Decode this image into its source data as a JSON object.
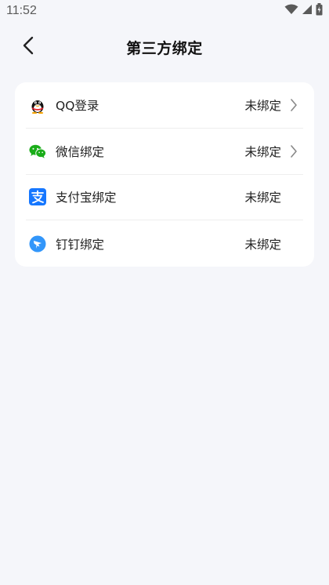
{
  "status_bar": {
    "time": "11:52"
  },
  "header": {
    "title": "第三方绑定"
  },
  "bindings": [
    {
      "label": "QQ登录",
      "status": "未绑定",
      "icon": "qq-icon",
      "has_arrow": true
    },
    {
      "label": "微信绑定",
      "status": "未绑定",
      "icon": "wechat-icon",
      "has_arrow": true
    },
    {
      "label": "支付宝绑定",
      "status": "未绑定",
      "icon": "alipay-icon",
      "has_arrow": false
    },
    {
      "label": "钉钉绑定",
      "status": "未绑定",
      "icon": "dingtalk-icon",
      "has_arrow": false
    }
  ],
  "colors": {
    "background": "#f5f6fa",
    "card": "#ffffff",
    "wechat": "#1aad19",
    "alipay": "#1677ff",
    "dingtalk": "#3296fa"
  }
}
